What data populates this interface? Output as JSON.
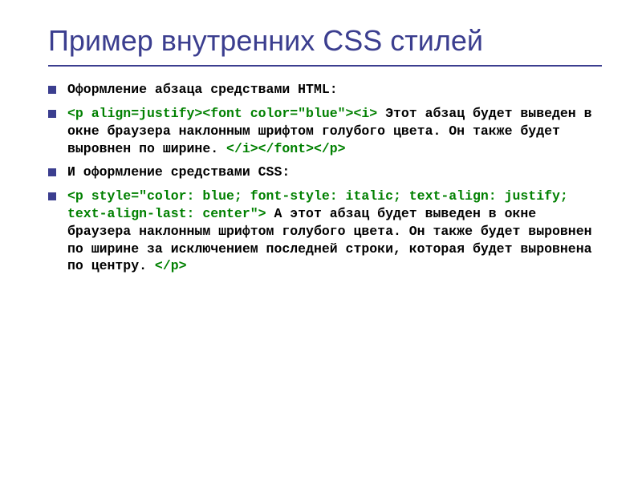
{
  "title": "Пример внутренних CSS стилей",
  "section1": {
    "label": "Оформление абзаца средствами HTML:",
    "code_open": "<p align=justify><font color=\"blue\"><i>",
    "text": " Этот абзац будет выведен в окне браузера наклонным шрифтом голубого цвета. Он также будет выровнен по ширине. ",
    "code_close": "</i></font></p>"
  },
  "section2": {
    "label": "И оформление средствами CSS:",
    "code_open": "<p style=\"color: blue; font-style: italic; text-align: justify; text-align-last: center\">",
    "text": " А этот абзац будет выведен в окне браузера наклонным шрифтом голубого цвета. Он также будет выровнен по ширине за исключением последней строки, которая будет выровнена по центру. ",
    "code_close": "</p>"
  }
}
